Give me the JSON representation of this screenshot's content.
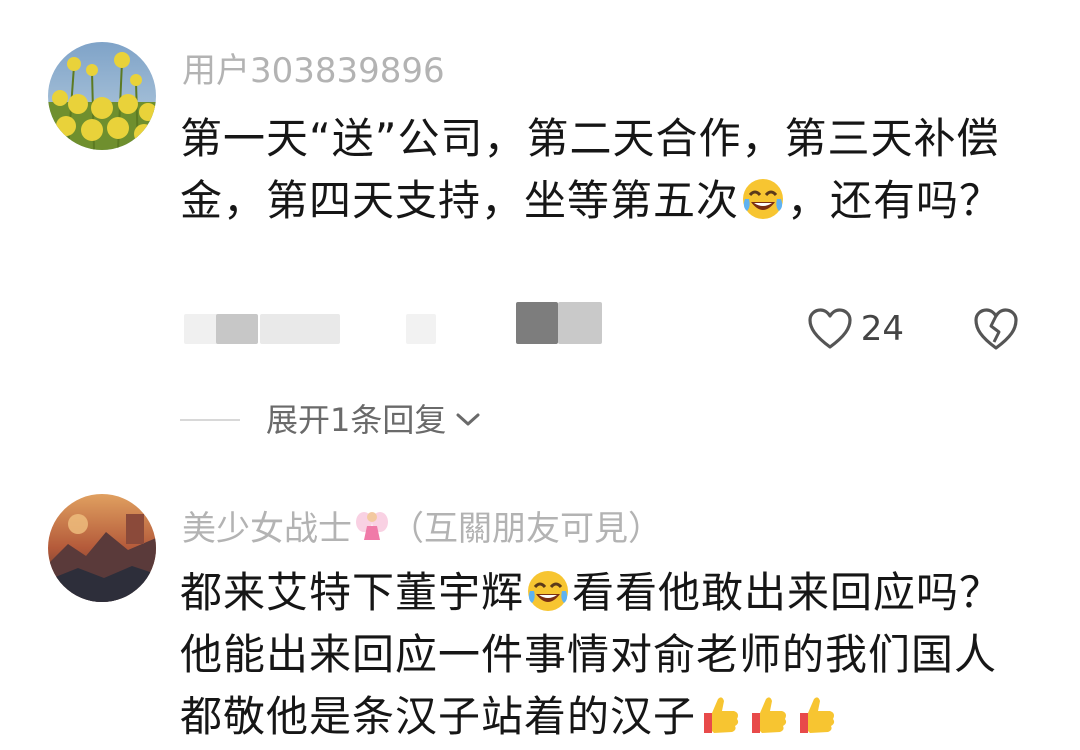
{
  "comments": [
    {
      "username": "用户303839896",
      "text_parts": [
        "第一天“送”公司，第二天合作，第三天补偿金，第四天支持，坐等第五次",
        "，还有吗？"
      ],
      "emoji": "laughing-tears-emoji",
      "like_count": "24",
      "icons": {
        "like": "heart-outline-icon",
        "dislike": "broken-heart-icon"
      }
    },
    {
      "username": "美少女战士",
      "username_suffix": "（互關朋友可見）",
      "text_parts": [
        "都来艾特下董宇辉",
        "看看他敢出来回应吗？他能出来回应一件事情对俞老师的我们国人都敬他是条汉子站着的汉子"
      ],
      "emoji": "laughing-tears-emoji",
      "trailing_emoji": "thumbs-up-emoji"
    }
  ],
  "expand_replies": {
    "label": "展开1条回复",
    "icon": "chevron-down-icon"
  },
  "colors": {
    "username": "#b3b3b3",
    "text": "#161616",
    "secondary": "#6a6a6a",
    "emoji_yellow": "#f7c531"
  }
}
